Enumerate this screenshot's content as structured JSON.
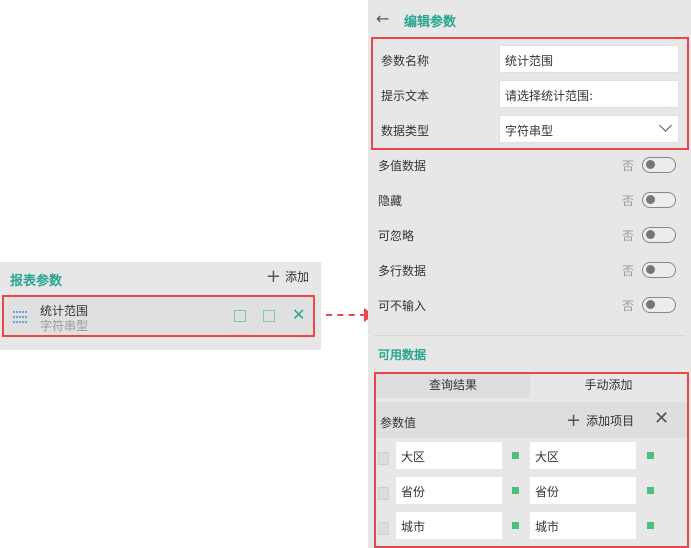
{
  "left": {
    "title": "报表参数",
    "add_label": "添加",
    "param": {
      "name": "统计范围",
      "type": "字符串型"
    }
  },
  "right": {
    "title": "编辑参数",
    "form": {
      "name_label": "参数名称",
      "name_value": "统计范围",
      "hint_label": "提示文本",
      "hint_value": "请选择统计范围:",
      "type_label": "数据类型",
      "type_value": "字符串型"
    },
    "toggles": [
      {
        "label": "多值数据",
        "state": "否"
      },
      {
        "label": "隐藏",
        "state": "否"
      },
      {
        "label": "可忽略",
        "state": "否"
      },
      {
        "label": "多行数据",
        "state": "否"
      },
      {
        "label": "可不输入",
        "state": "否"
      }
    ],
    "available": {
      "title": "可用数据",
      "tabs": [
        "查询结果",
        "手动添加"
      ],
      "value_label": "参数值",
      "add_item_label": "添加项目",
      "rows": [
        {
          "a": "大区",
          "b": "大区"
        },
        {
          "a": "省份",
          "b": "省份"
        },
        {
          "a": "城市",
          "b": "城市"
        }
      ]
    }
  },
  "colors": {
    "accent": "#2aa68f",
    "highlight": "#e8474c",
    "indicator": "#4cbf7a"
  }
}
